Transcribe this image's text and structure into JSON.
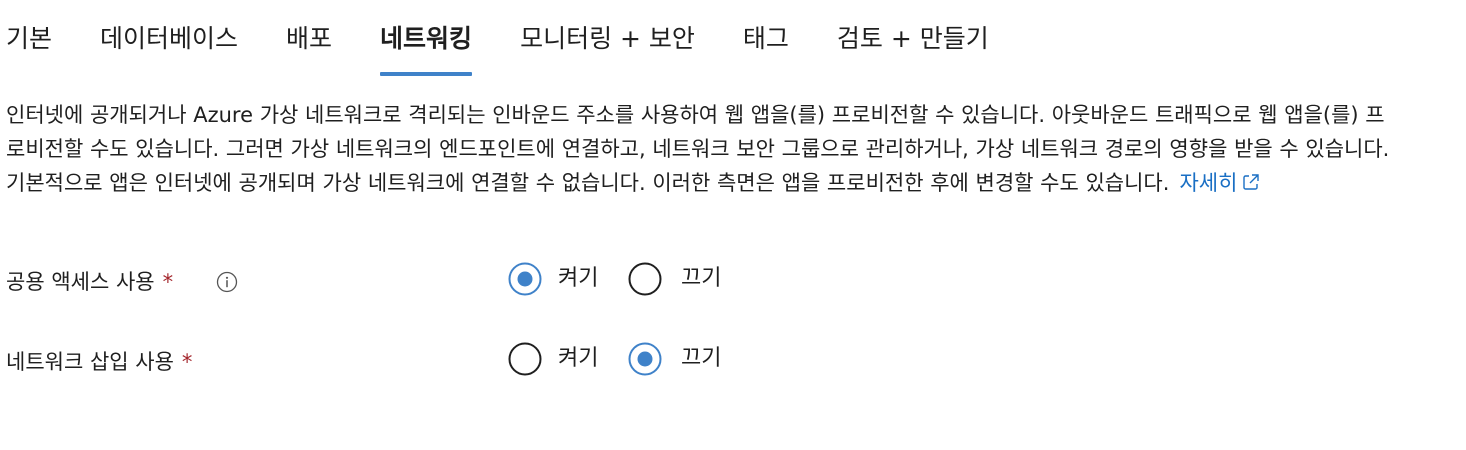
{
  "tabs": [
    {
      "label": "기본",
      "active": false
    },
    {
      "label": "데이터베이스",
      "active": false
    },
    {
      "label": "배포",
      "active": false
    },
    {
      "label": "네트워킹",
      "active": true
    },
    {
      "label": "모니터링 + 보안",
      "active": false
    },
    {
      "label": "태그",
      "active": false
    },
    {
      "label": "검토 + 만들기",
      "active": false
    }
  ],
  "description": {
    "text": "인터넷에 공개되거나 Azure 가상 네트워크로 격리되는 인바운드 주소를 사용하여 웹 앱을(를) 프로비전할 수 있습니다. 아웃바운드 트래픽으로 웹 앱을(를) 프로비전할 수도 있습니다. 그러면 가상 네트워크의 엔드포인트에 연결하고, 네트워크 보안 그룹으로 관리하거나, 가상 네트워크 경로의 영향을 받을 수 있습니다. 기본적으로 앱은 인터넷에 공개되며 가상 네트워크에 연결할 수 없습니다. 이러한 측면은 앱을 프로비전한 후에 변경할 수도 있습니다.",
    "link_label": "자세히",
    "link_icon": "external-link-icon"
  },
  "settings": {
    "public_access": {
      "label": "공용 액세스 사용",
      "required_mark": "*",
      "info_icon": "info-icon",
      "on_label": "켜기",
      "off_label": "끄기",
      "selected": "on"
    },
    "network_injection": {
      "label": "네트워크 삽입 사용",
      "required_mark": "*",
      "on_label": "켜기",
      "off_label": "끄기",
      "selected": "off"
    }
  },
  "colors": {
    "accent": "#3f82c9",
    "link": "#1a6fc4",
    "required": "#a4262c",
    "text": "#1f1f1f"
  }
}
